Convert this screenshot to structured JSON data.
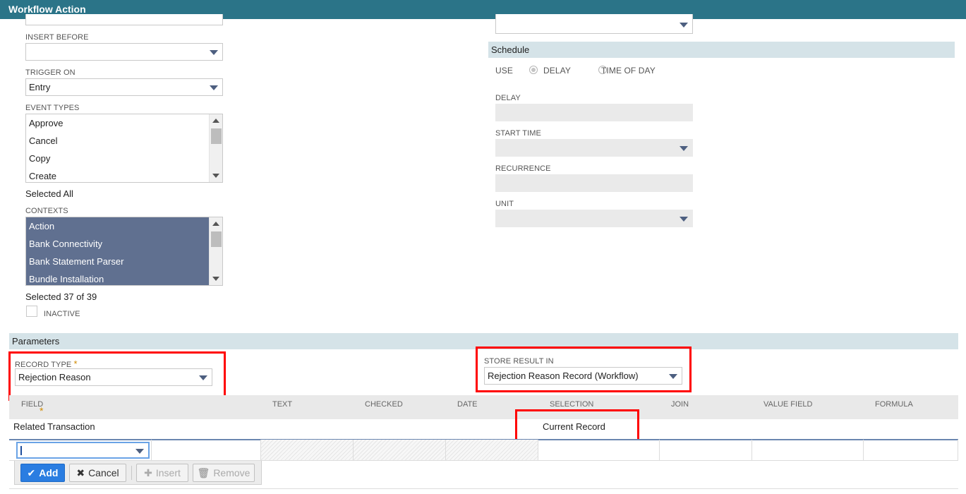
{
  "window": {
    "title": "Workflow Action"
  },
  "left": {
    "insert_before": {
      "label": "INSERT BEFORE",
      "value": ""
    },
    "trigger_on": {
      "label": "TRIGGER ON",
      "value": "Entry"
    },
    "event_types": {
      "label": "EVENT TYPES",
      "options": [
        "Approve",
        "Cancel",
        "Copy",
        "Create"
      ],
      "status": "Selected All"
    },
    "contexts": {
      "label": "CONTEXTS",
      "options": [
        "Action",
        "Bank Connectivity",
        "Bank Statement Parser",
        "Bundle Installation"
      ],
      "status": "Selected 37 of 39"
    },
    "inactive": {
      "label": "INACTIVE",
      "checked": false
    }
  },
  "schedule": {
    "header": "Schedule",
    "use_label": "USE",
    "delay_option": "DELAY",
    "time_of_day_option": "TIME OF DAY",
    "delay_label": "DELAY",
    "start_time_label": "START TIME",
    "recurrence_label": "RECURRENCE",
    "unit_label": "UNIT"
  },
  "parameters": {
    "header": "Parameters",
    "record_type": {
      "label": "RECORD TYPE",
      "required_mark": "*",
      "value": "Rejection Reason"
    },
    "store_result_in": {
      "label": "STORE RESULT IN",
      "value": "Rejection Reason Record (Workflow)"
    },
    "columns": [
      "FIELD",
      "TEXT",
      "CHECKED",
      "DATE",
      "SELECTION",
      "JOIN",
      "VALUE FIELD",
      "FORMULA"
    ],
    "field_required_mark": "*",
    "rows": [
      {
        "field": "Related Transaction",
        "selection": "Current Record"
      }
    ]
  },
  "toolbar": {
    "add_label": "Add",
    "cancel_label": "Cancel",
    "insert_label": "Insert",
    "remove_label": "Remove"
  },
  "colors": {
    "titlebar": "#2b7488",
    "section_header": "#d5e3e8",
    "selected_list": "#607090",
    "primary_button": "#2a7de1",
    "highlight": "#ff0000"
  }
}
